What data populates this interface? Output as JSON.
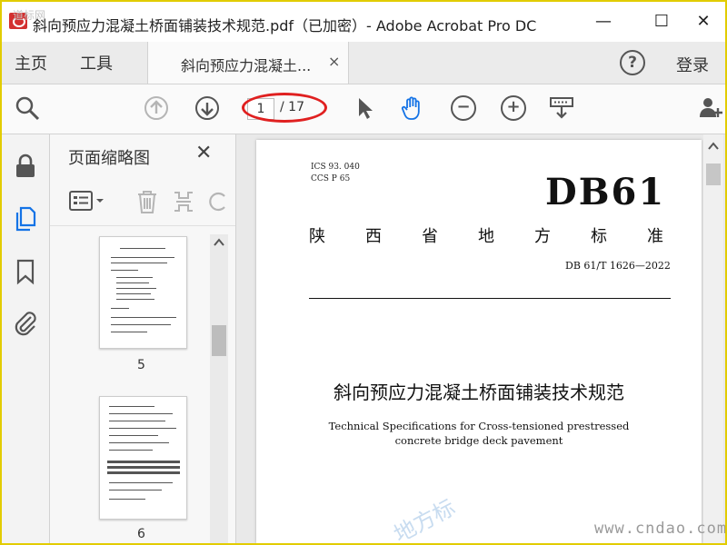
{
  "window": {
    "title": "斜向预应力混凝土桥面铺装技术规范.pdf（已加密）- Adobe Acrobat Pro DC",
    "minimize": "—",
    "maximize": "☐",
    "close": "✕"
  },
  "menu": {
    "home": "主页",
    "tools": "工具",
    "tab_label": "斜向预应力混凝土...",
    "tab_close": "×",
    "help": "?",
    "login": "登录"
  },
  "toolbar": {
    "current_page": "1",
    "page_total": "/ 17",
    "zoom_out": "−",
    "zoom_in": "+"
  },
  "thumbnails": {
    "panel_title": "页面缩略图",
    "close": "✕",
    "pages": [
      {
        "number": "5"
      },
      {
        "number": "6"
      }
    ]
  },
  "document": {
    "ics_line1": "ICS 93. 040",
    "ics_line2": "CCS P 65",
    "std_code": "DB61",
    "province_chars": [
      "陕",
      "西",
      "省",
      "地",
      "方",
      "标",
      "准"
    ],
    "std_number": "DB 61/T  1626—2022",
    "title_cn": "斜向预应力混凝土桥面铺装技术规范",
    "title_en": "Technical Specifications for Cross-tensioned prestressed concrete bridge deck pavement"
  },
  "watermarks": {
    "diagonal": "地方标",
    "site": "www.cndao.com",
    "corner": "道标网"
  },
  "colors": {
    "highlight_oval": "#e02020",
    "active_blue": "#1473e6",
    "frame_border": "#e2cc00"
  }
}
